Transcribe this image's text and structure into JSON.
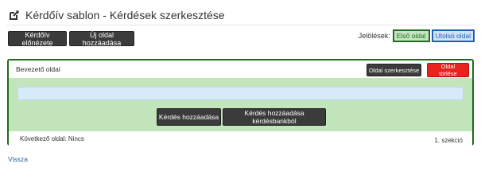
{
  "header": {
    "title": "Kérdőív sablon - Kérdések szerkesztése",
    "icon": "edit-icon"
  },
  "toolbar": {
    "preview_label": "Kérdőív előnézete",
    "add_page_label": "Új oldal hozzáadása"
  },
  "markers": {
    "label": "Jelölések:",
    "first_page": "Első oldal",
    "last_page": "Utolsó oldal",
    "first_color": "#1f6d1f",
    "last_color": "#2060b0"
  },
  "section": {
    "page_name": "Bevezető oldal",
    "edit_label": "Oldal szerkesztése",
    "delete_label": "Oldal törlése",
    "add_question_label": "Kérdés hozzáadása",
    "add_from_bank_label": "Kérdés hozzáadása kérdésbankból",
    "next_page_label": "Következő oldal: Nincs",
    "section_label": "1. szekció",
    "border_color": "#1a6e1a",
    "body_color": "#c2e5bc"
  },
  "footer": {
    "back_label": "Vissza"
  }
}
